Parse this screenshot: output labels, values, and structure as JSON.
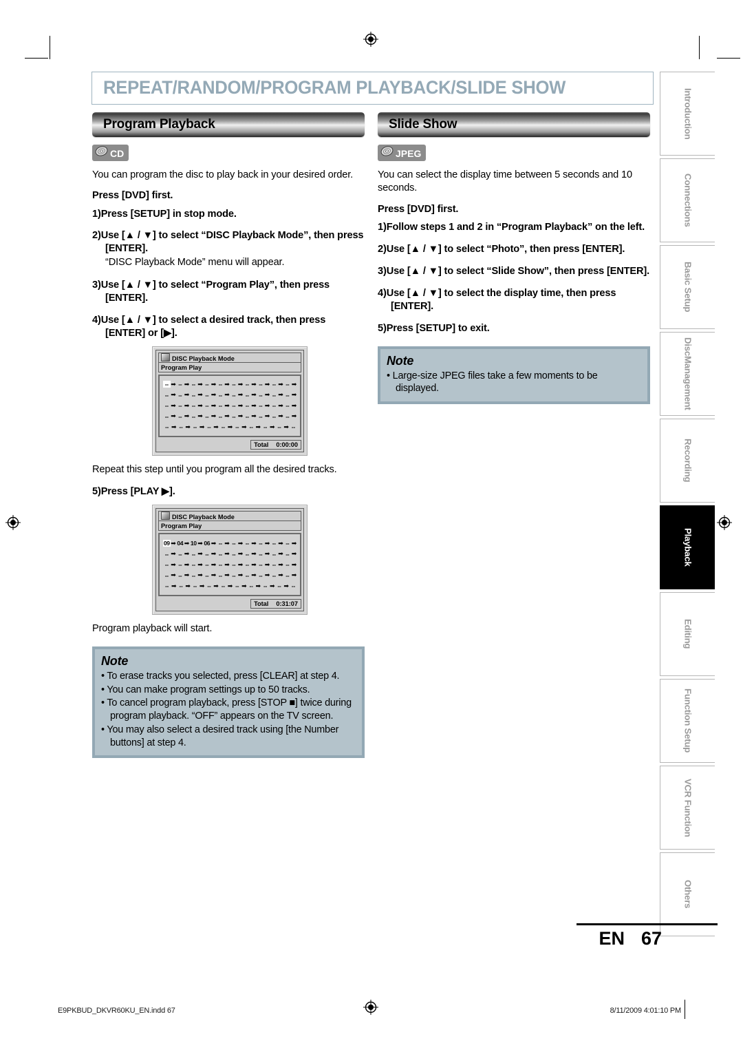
{
  "chapter": {
    "title": "REPEAT/RANDOM/PROGRAM PLAYBACK/SLIDE SHOW"
  },
  "left": {
    "section_title": "Program Playback",
    "badge": {
      "icon": "disc-icon",
      "label": "CD"
    },
    "intro": "You can program the disc to play back in your desired order.",
    "press_dvd": "Press [DVD] first.",
    "steps": [
      {
        "num": "1)",
        "text": "Press [SETUP] in stop mode."
      },
      {
        "num": "2)",
        "text": "Use [▲ / ▼] to select “DISC Playback Mode”, then press [ENTER].",
        "sub": "“DISC Playback Mode” menu will appear."
      },
      {
        "num": "3)",
        "text": "Use [▲ / ▼] to select “Program Play”, then press [ENTER]."
      },
      {
        "num": "4)",
        "text": "Use [▲ / ▼] to select a desired track, then press [ENTER] or [▶]."
      }
    ],
    "repeat_text": "Repeat this step until you program all the desired tracks.",
    "step5": {
      "num": "5)",
      "text": "Press [PLAY ▶]."
    },
    "after_text": "Program playback will start.",
    "note": {
      "heading": "Note",
      "items": [
        "To erase tracks you selected, press [CLEAR] at step 4.",
        "You can make program settings up to 50 tracks.",
        "To cancel program playback, press [STOP ■] twice during program playback. “OFF” appears on the TV screen.",
        "You may also select a desired track using [the Number buttons] at step 4."
      ]
    }
  },
  "right": {
    "section_title": "Slide Show",
    "badge": {
      "icon": "disc-icon",
      "label": "JPEG"
    },
    "intro": "You can select the display time between 5 seconds and 10 seconds.",
    "press_dvd": "Press [DVD] first.",
    "steps": [
      {
        "num": "1)",
        "text": "Follow steps 1 and 2 in “Program Playback” on the left."
      },
      {
        "num": "2)",
        "text": "Use [▲ / ▼] to select “Photo”, then press [ENTER]."
      },
      {
        "num": "3)",
        "text": "Use [▲ / ▼] to select “Slide Show”, then press [ENTER]."
      },
      {
        "num": "4)",
        "text": "Use [▲ / ▼] to select the display time, then press [ENTER]."
      },
      {
        "num": "5)",
        "text": "Press [SETUP] to exit."
      }
    ],
    "note": {
      "heading": "Note",
      "items": [
        "Large-size JPEG files take a few moments to be displayed."
      ]
    }
  },
  "osd_screens": [
    {
      "title": "DISC Playback Mode",
      "subtitle": "Program Play",
      "tracks": [
        "--",
        "--",
        "--",
        "--",
        "--",
        "--",
        "--",
        "--",
        "--",
        "--",
        "--",
        "--",
        "--",
        "--",
        "--",
        "--",
        "--",
        "--",
        "--",
        "--",
        "--",
        "--",
        "--",
        "--",
        "--",
        "--",
        "--",
        "--",
        "--",
        "--",
        "--",
        "--",
        "--",
        "--",
        "--",
        "--",
        "--",
        "--",
        "--",
        "--",
        "--",
        "--",
        "--",
        "--",
        "--",
        "--",
        "--",
        "--",
        "--",
        "--"
      ],
      "highlight_index": 0,
      "total_label": "Total",
      "total_value": "0:00:00"
    },
    {
      "title": "DISC Playback Mode",
      "subtitle": "Program Play",
      "tracks": [
        "09",
        "04",
        "10",
        "06",
        "--",
        "--",
        "--",
        "--",
        "--",
        "--",
        "--",
        "--",
        "--",
        "--",
        "--",
        "--",
        "--",
        "--",
        "--",
        "--",
        "--",
        "--",
        "--",
        "--",
        "--",
        "--",
        "--",
        "--",
        "--",
        "--",
        "--",
        "--",
        "--",
        "--",
        "--",
        "--",
        "--",
        "--",
        "--",
        "--",
        "--",
        "--",
        "--",
        "--",
        "--",
        "--",
        "--",
        "--",
        "--",
        "--"
      ],
      "highlight_index": 0,
      "total_label": "Total",
      "total_value": "0:31:07"
    }
  ],
  "side_tabs": [
    {
      "label": "Introduction",
      "active": false
    },
    {
      "label": "Connections",
      "active": false
    },
    {
      "label": "Basic Setup",
      "active": false
    },
    {
      "label": "Disc\nManagement",
      "active": false
    },
    {
      "label": "Recording",
      "active": false
    },
    {
      "label": "Playback",
      "active": true
    },
    {
      "label": "Editing",
      "active": false
    },
    {
      "label": "Function Setup",
      "active": false
    },
    {
      "label": "VCR Function",
      "active": false
    },
    {
      "label": "Others",
      "active": false
    }
  ],
  "page": {
    "lang": "EN",
    "number": "67"
  },
  "footer": {
    "file": "E9PKBUD_DKVR60KU_EN.indd  67",
    "timestamp": "8/11/2009  4:01:10 PM"
  },
  "colors": {
    "title": "#94a9b6",
    "note_bg": "#b4c3cb",
    "note_border": "#93a8b4",
    "badge": "#8c8c8c",
    "tab_text": "#9a9a9a"
  }
}
